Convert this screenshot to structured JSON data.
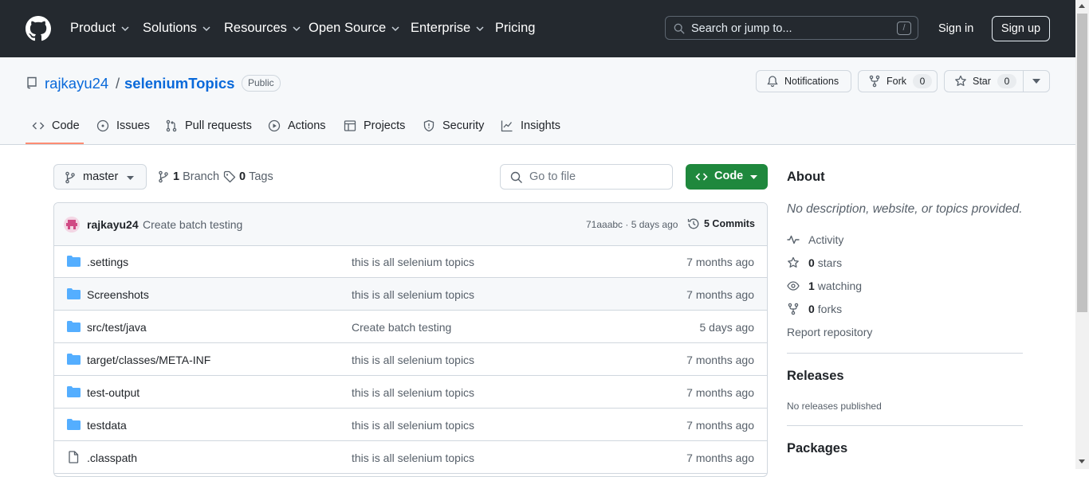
{
  "header": {
    "nav": [
      "Product",
      "Solutions",
      "Resources",
      "Open Source",
      "Enterprise",
      "Pricing"
    ],
    "search_placeholder": "Search or jump to...",
    "search_shortcut": "/",
    "signin": "Sign in",
    "signup": "Sign up"
  },
  "repo": {
    "owner": "rajkayu24",
    "separator": "/",
    "name": "seleniumTopics",
    "visibility": "Public",
    "notifications_label": "Notifications",
    "fork_label": "Fork",
    "fork_count": "0",
    "star_label": "Star",
    "star_count": "0"
  },
  "tabs": [
    "Code",
    "Issues",
    "Pull requests",
    "Actions",
    "Projects",
    "Security",
    "Insights"
  ],
  "toolbar": {
    "branch": "master",
    "branch_count": "1",
    "branch_label": "Branch",
    "tag_count": "0",
    "tag_label": "Tags",
    "goto_placeholder": "Go to file",
    "code_label": "Code"
  },
  "commit": {
    "author": "rajkayu24",
    "message": "Create batch testing",
    "hash_date": "71aaabc · 5 days ago",
    "commits_label": "5 Commits"
  },
  "files": [
    {
      "name": ".settings",
      "type": "dir",
      "message": "this is all selenium topics",
      "date": "7 months ago"
    },
    {
      "name": "Screenshots",
      "type": "dir",
      "message": "this is all selenium topics",
      "date": "7 months ago"
    },
    {
      "name": "src/test/java",
      "type": "dir",
      "message": "Create batch testing",
      "date": "5 days ago"
    },
    {
      "name": "target/classes/META-INF",
      "type": "dir",
      "message": "this is all selenium topics",
      "date": "7 months ago"
    },
    {
      "name": "test-output",
      "type": "dir",
      "message": "this is all selenium topics",
      "date": "7 months ago"
    },
    {
      "name": "testdata",
      "type": "dir",
      "message": "this is all selenium topics",
      "date": "7 months ago"
    },
    {
      "name": ".classpath",
      "type": "file",
      "message": "this is all selenium topics",
      "date": "7 months ago"
    }
  ],
  "about": {
    "heading": "About",
    "description": "No description, website, or topics provided.",
    "activity": "Activity",
    "stars_count": "0",
    "stars_label": "stars",
    "watching_count": "1",
    "watching_label": "watching",
    "forks_count": "0",
    "forks_label": "forks",
    "report": "Report repository"
  },
  "releases": {
    "heading": "Releases",
    "text": "No releases published"
  },
  "packages": {
    "heading": "Packages"
  },
  "colors": {
    "header_bg": "#24292f",
    "link": "#0969da",
    "primary_button": "#1f883d",
    "folder": "#54aeff",
    "active_tab": "#fd8c73"
  }
}
